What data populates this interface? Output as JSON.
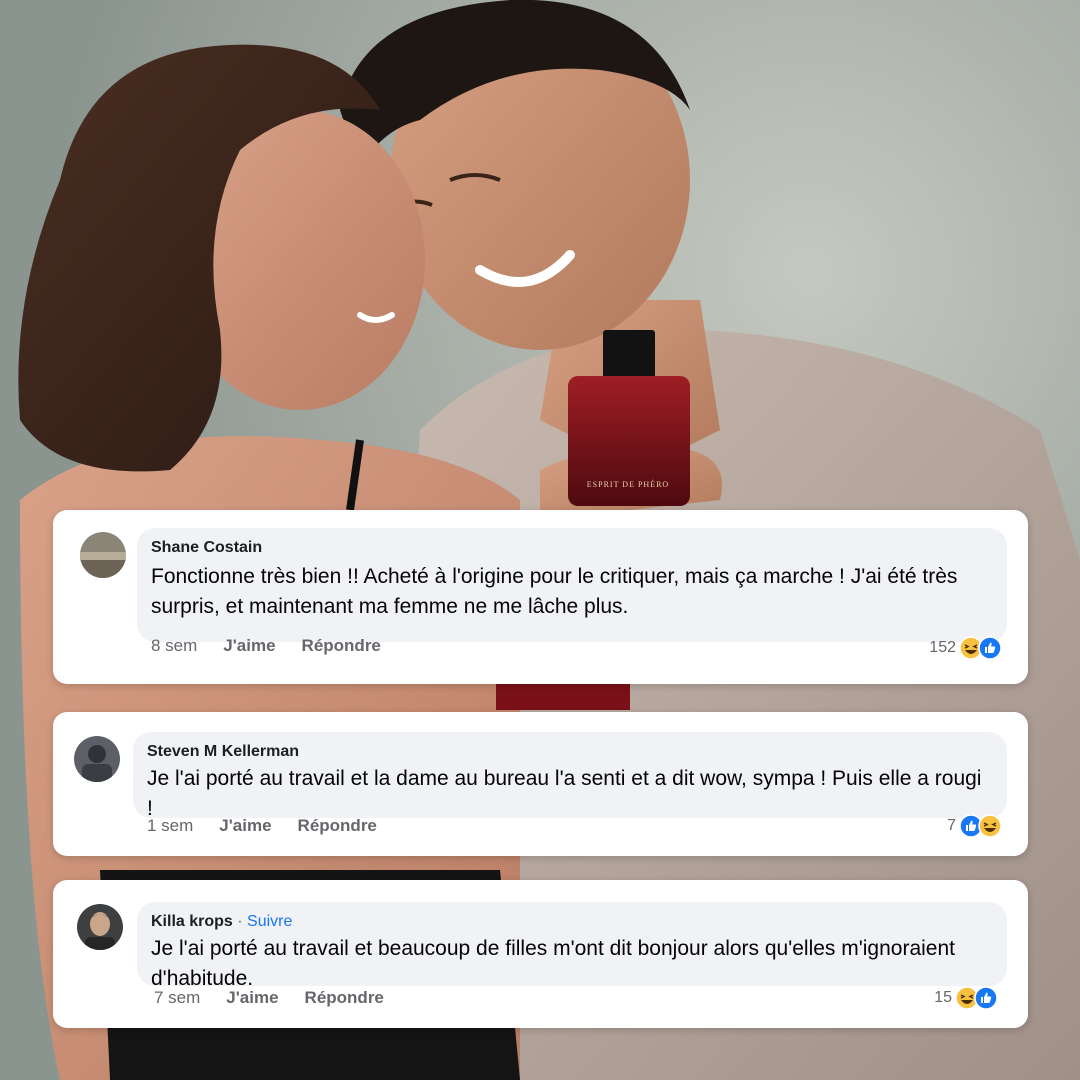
{
  "background": {
    "bottle_label": "ESPRIT DE PHÉRO"
  },
  "comments": [
    {
      "author": "Shane Costain",
      "follow": "",
      "text": "Fonctionne très bien !! Acheté à l'origine pour le critiquer, mais ça marche ! J'ai été très surpris, et maintenant ma femme ne me lâche plus.",
      "time": "8 sem",
      "like_label": "J'aime",
      "reply_label": "Répondre",
      "reaction_count": "152",
      "reaction_icons": [
        "haha-icon",
        "like-icon"
      ]
    },
    {
      "author": "Steven M Kellerman",
      "follow": "",
      "text": "Je l'ai porté au travail et la dame au bureau l'a senti et a dit wow, sympa ! Puis elle a rougi !",
      "time": "1 sem",
      "like_label": "J'aime",
      "reply_label": "Répondre",
      "reaction_count": "7",
      "reaction_icons": [
        "like-icon",
        "haha-icon"
      ]
    },
    {
      "author": "Killa krops",
      "follow": "Suivre",
      "text": "Je l'ai porté au travail et beaucoup de filles m'ont dit bonjour alors qu'elles m'ignoraient d'habitude.",
      "time": "7 sem",
      "like_label": "J'aime",
      "reply_label": "Répondre",
      "reaction_count": "15",
      "reaction_icons": [
        "haha-icon",
        "like-icon"
      ]
    }
  ],
  "colors": {
    "card_bg": "#ffffff",
    "bubble_bg": "#f0f2f5",
    "link_blue": "#1877f2",
    "meta_gray": "#65676b",
    "like_blue": "#1877f2",
    "haha_yellow": "#f7c13f"
  }
}
